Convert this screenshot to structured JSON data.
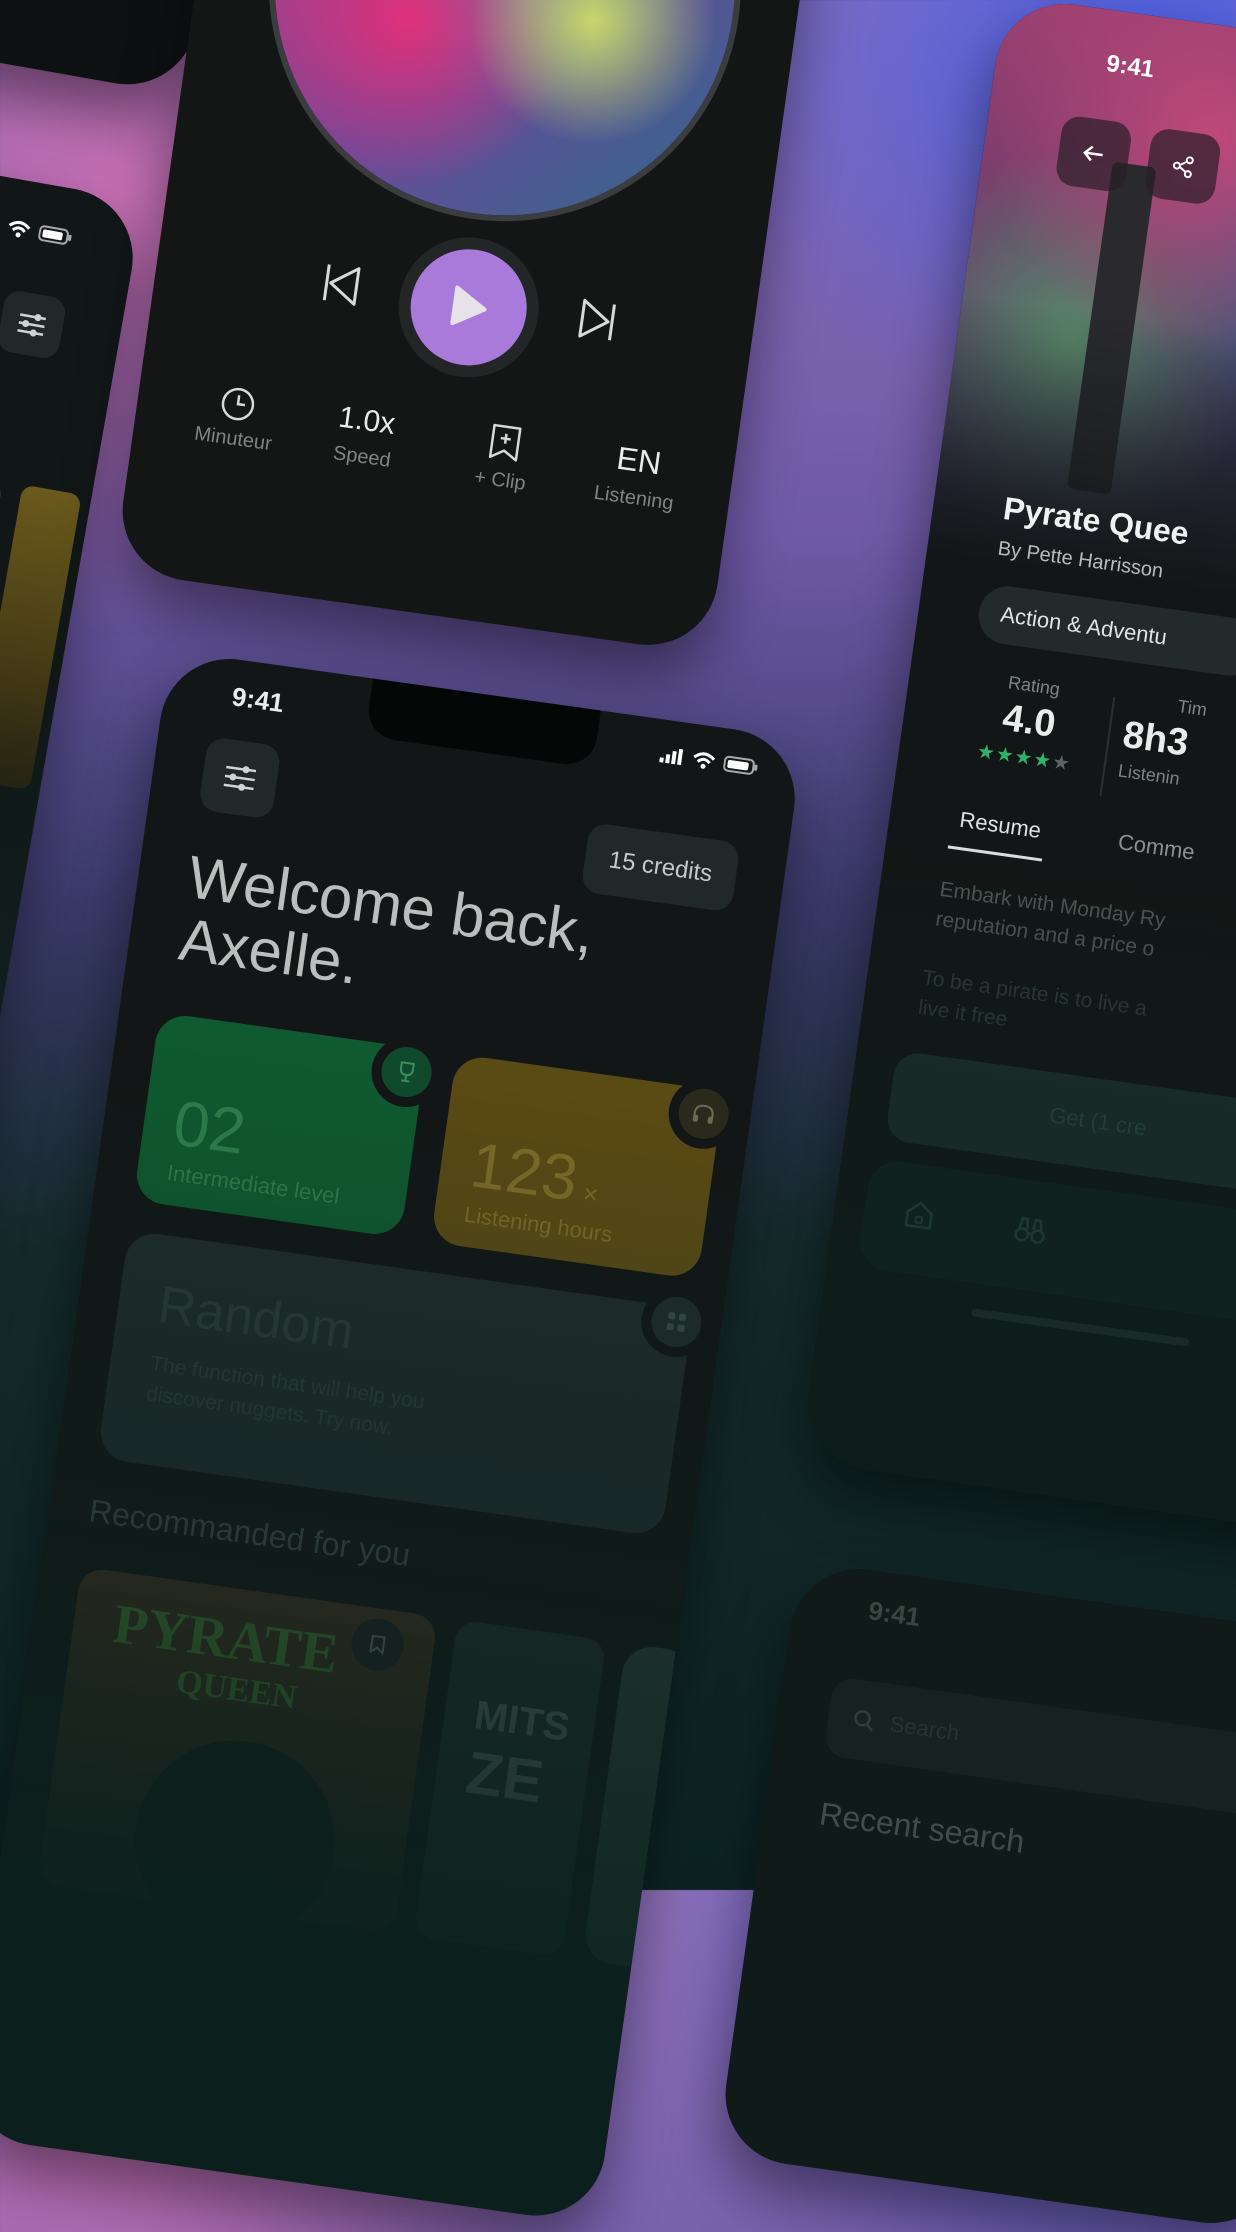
{
  "player": {
    "controls": {
      "timer_label": "Minuteur",
      "speed_value": "1.0x",
      "speed_label": "Speed",
      "clip_label": "+ Clip",
      "lang_value": "EN",
      "lang_label": "Listening"
    },
    "accent": "#a97ad9"
  },
  "home": {
    "time": "9:41",
    "credits": "15 credits",
    "greeting": "Welcome back,\nAxelle.",
    "stats": [
      {
        "value": "02",
        "label": "Intermediate level",
        "icon": "trophy-icon",
        "color": "#0f4a2c"
      },
      {
        "value": "123",
        "suffix": "×",
        "label": "Listening hours",
        "icon": "headphones-icon",
        "color": "#5a4a14"
      }
    ],
    "random": {
      "title": "Random",
      "text": "The function that will help you discover nuggets. Try now."
    },
    "recommended_title": "Recommanded for you",
    "books": [
      {
        "cover_title": "PYRATE",
        "cover_sub": "QUEEN"
      },
      {
        "cover_title": "MITS",
        "cover_sub": "ZE"
      }
    ]
  },
  "detail": {
    "time": "9:41",
    "title": "Pyrate Quee",
    "author": "By Pette Harrisson",
    "genre": "Action & Adventu",
    "rating_label": "Rating",
    "rating_value": "4.0",
    "time_label": "Tim",
    "time_value": "8h3",
    "time_sub": "Listenin",
    "tabs": [
      "Resume",
      "Comme"
    ],
    "desc1": "Embark with Monday Ry\nreputation and a price o",
    "desc2": "To be a pirate is to live a\nlive it free",
    "cta": "Get (1 cre"
  },
  "search": {
    "time": "9:41",
    "placeholder": "Search",
    "recent_title": "Recent search"
  },
  "star_color": "#2fb36a"
}
